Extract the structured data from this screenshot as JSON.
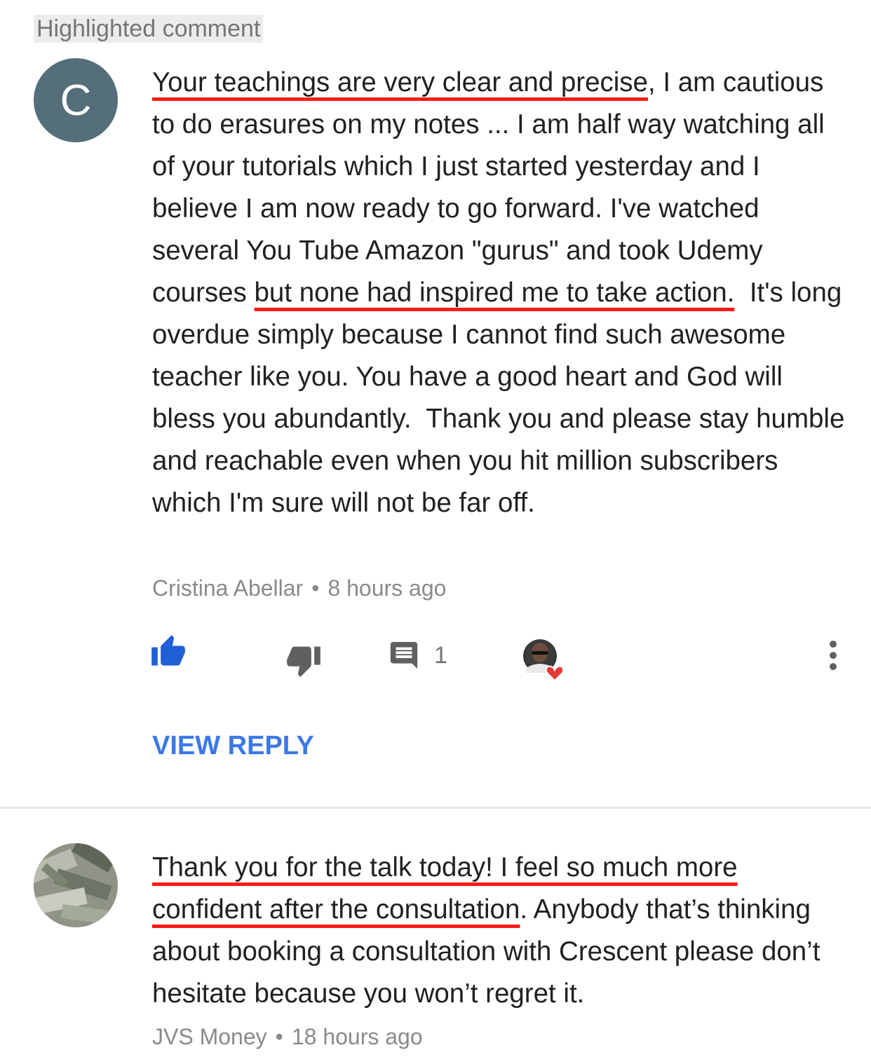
{
  "highlight_label": "Highlighted comment",
  "comments": [
    {
      "avatar_letter": "C",
      "text_parts": [
        {
          "text": "Your teachings are very clear and precise",
          "underlined": true
        },
        {
          "text": ", I am cautious to do erasures on my notes ... I am half way watching all of your tutorials which I just started yesterday and I believe I am now ready to go forward. I've watched several You Tube Amazon \"gurus\" and took Udemy courses ",
          "underlined": false
        },
        {
          "text": "but none had inspired me to take action.",
          "underlined": true
        },
        {
          "text": "  It's long overdue simply because I cannot find such awesome teacher like you. You have a good heart and God will bless you abundantly.  Thank you and please stay humble and reachable even when you hit million subscribers which I'm sure will not be far off.",
          "underlined": false
        }
      ],
      "author": "Cristina Abellar",
      "separator": "•",
      "time": "8 hours ago",
      "reply_count": "1",
      "view_reply_label": "VIEW REPLY",
      "liked": true,
      "like_icon": "thumb-up-icon",
      "dislike_icon": "thumb-down-icon",
      "reply_icon": "comment-icon",
      "creator_heart_icon": "creator-heart-icon",
      "more_icon": "more-vert-icon"
    },
    {
      "text_parts": [
        {
          "text": "Thank you for the talk today! I feel so much more confident after the consultation",
          "underlined": true
        },
        {
          "text": ". Anybody that’s thinking about booking a consultation with Crescent please don’t hesitate because you won’t regret it.",
          "underlined": false
        }
      ],
      "author": "JVS Money",
      "separator": "•",
      "time": "18 hours ago"
    }
  ],
  "colors": {
    "underline": "#ff1a1a",
    "link": "#3b78e7",
    "like_active": "#1e5fd6",
    "avatar_bg": "#546e7a",
    "heart": "#e53935"
  }
}
